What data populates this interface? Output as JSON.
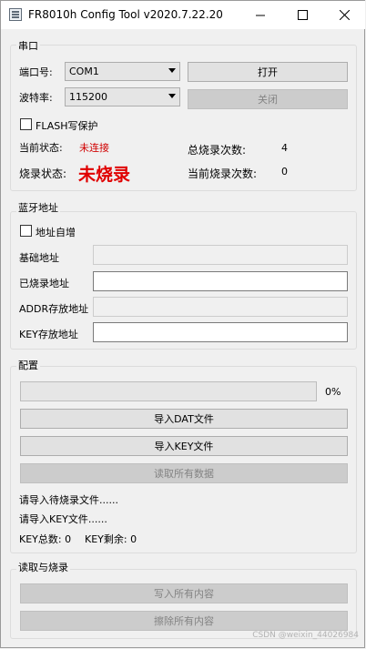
{
  "window": {
    "title": "FR8010h Config Tool v2020.7.22.20"
  },
  "serial": {
    "group_title": "串口",
    "port_label": "端口号:",
    "port_value": "COM1",
    "baud_label": "波特率:",
    "baud_value": "115200",
    "open_button": "打开",
    "close_button": "关闭",
    "flash_protect_label": "FLASH写保护",
    "current_status_label": "当前状态:",
    "current_status_value": "未连接",
    "total_burn_label": "总烧录次数:",
    "total_burn_value": "4",
    "burn_status_label": "烧录状态:",
    "burn_status_value": "未烧录",
    "current_burn_label": "当前烧录次数:",
    "current_burn_value": "0",
    "status_color": "#d00000"
  },
  "bt_address": {
    "group_title": "蓝牙地址",
    "auto_increment_label": "地址自增",
    "base_address_label": "基础地址",
    "base_address_value": "",
    "burned_address_label": "已烧录地址",
    "burned_address_value": "",
    "addr_storage_label": "ADDR存放地址",
    "addr_storage_value": "",
    "key_storage_label": "KEY存放地址",
    "key_storage_value": ""
  },
  "config": {
    "group_title": "配置",
    "progress_percent": 0,
    "progress_text": "0%",
    "import_dat_button": "导入DAT文件",
    "import_key_button": "导入KEY文件",
    "read_all_button": "读取所有数据",
    "import_burn_file_msg": "请导入待烧录文件......",
    "import_key_file_msg": "请导入KEY文件......",
    "key_total": "KEY总数: 0",
    "key_remaining": "KEY剩余: 0"
  },
  "read_burn": {
    "group_title": "读取与烧录",
    "write_all_button": "写入所有内容",
    "erase_all_button": "擦除所有内容"
  },
  "watermark": "CSDN @weixin_44026984"
}
